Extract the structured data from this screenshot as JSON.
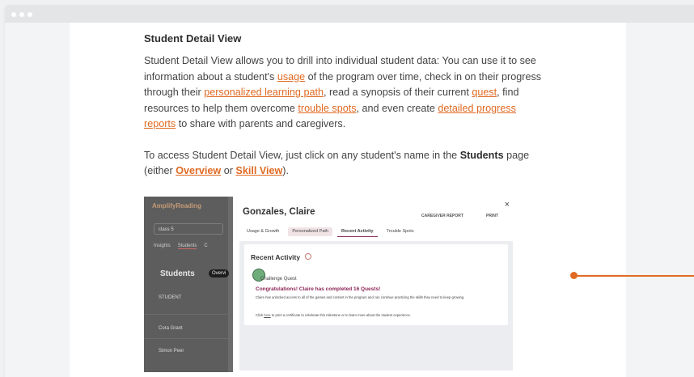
{
  "section_title": "Student Detail View",
  "p1": {
    "t1": "Student Detail View allows you to drill into individual student data: You can use it to see information about a student's ",
    "link_usage": "usage",
    "t2": " of the program over time, check in on their progress through their ",
    "link_path": "personalized learning path",
    "t3": ", read a synopsis of their current ",
    "link_quest": "quest",
    "t4": ", find resources to help them overcome ",
    "link_trouble": "trouble spots",
    "t5": ", and even create ",
    "link_reports": "detailed progress reports",
    "t6": " to share with parents and caregivers."
  },
  "p2": {
    "t1": "To access Student Detail View, just click on any student's name in the ",
    "bold_students": "Students",
    "t2": " page (either ",
    "link_overview": "Overview",
    "t3": " or ",
    "link_skill": "Skill View",
    "t4": ")."
  },
  "screenshot": {
    "bg": {
      "brand": "AmplifyReading",
      "class_select": "class 5",
      "tabs": [
        "Insights",
        "Students",
        "C"
      ],
      "title": "Students",
      "overview_btn": "Overvi",
      "column": "STUDENT",
      "rows": [
        "Cora Grant",
        "Simon Peer"
      ]
    },
    "modal": {
      "student_name": "Gonzales, Claire",
      "close": "×",
      "caregiver_report": "CAREGIVER REPORT",
      "print": "PRINT",
      "tabs": [
        "Usage & Growth",
        "Personalized Path",
        "Recent Activity",
        "Trouble Spots"
      ],
      "card_title": "Recent Activity",
      "quest_label": "Challenge Quest",
      "congrats": "Congratulations! Claire has completed 16 Quests!",
      "body": "Claire has unlocked access to all of the games and content in the program and can continue practicing the skills they need to keep growing.",
      "body2_pre": "Click ",
      "body2_link": "here",
      "body2_post": " to print a certificate to celebrate this milestone or to learn more about the student experience."
    }
  },
  "colors": {
    "link": "#e06a23",
    "accent_purple": "#8c2455"
  }
}
